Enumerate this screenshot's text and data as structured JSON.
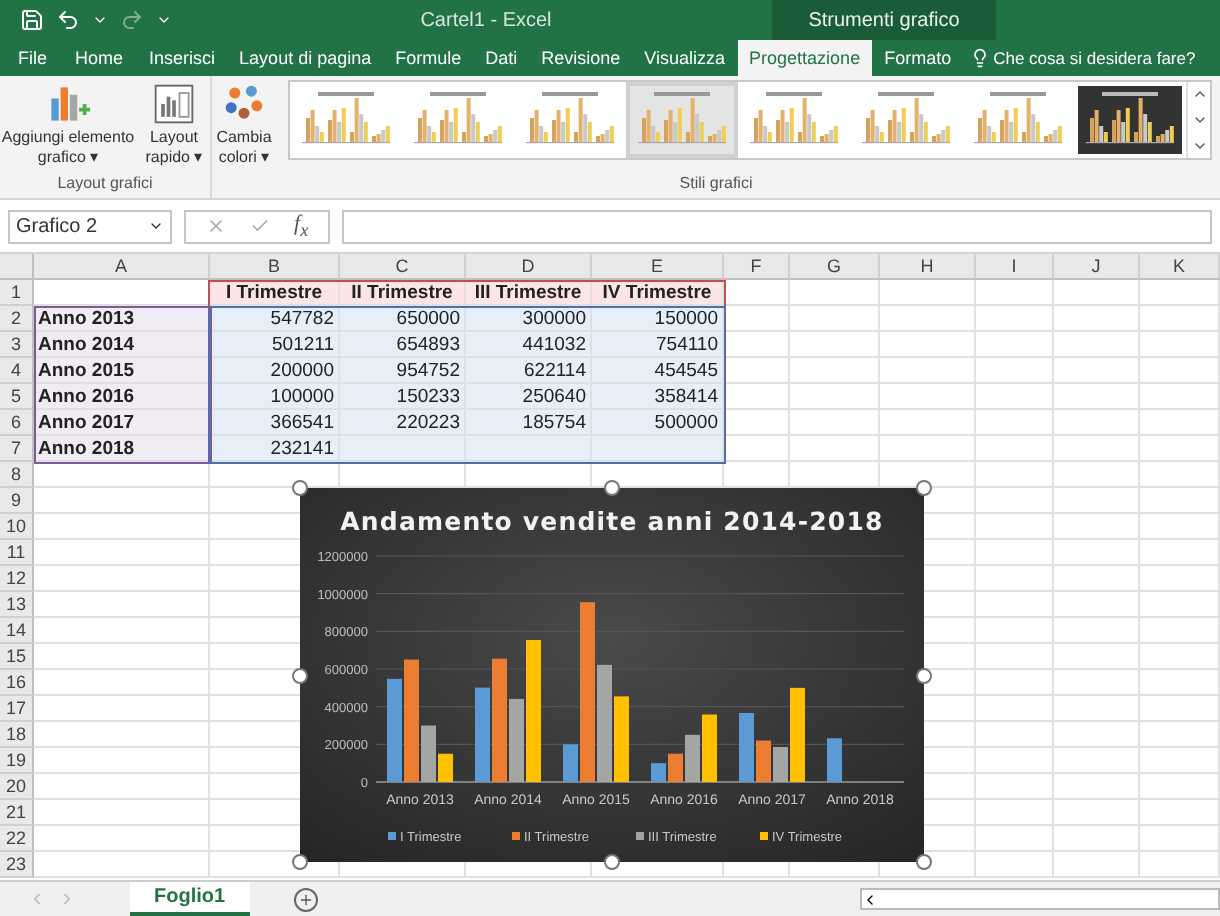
{
  "title_bar": {
    "title": "Cartel1 - Excel",
    "context_label": "Strumenti grafico"
  },
  "ribbon_tabs": [
    {
      "label": "File",
      "selected": false
    },
    {
      "label": "Home",
      "selected": false
    },
    {
      "label": "Inserisci",
      "selected": false
    },
    {
      "label": "Layout di pagina",
      "selected": false
    },
    {
      "label": "Formule",
      "selected": false
    },
    {
      "label": "Dati",
      "selected": false
    },
    {
      "label": "Revisione",
      "selected": false
    },
    {
      "label": "Visualizza",
      "selected": false
    },
    {
      "label": "Progettazione",
      "selected": true
    },
    {
      "label": "Formato",
      "selected": false
    }
  ],
  "tell_me": "Che cosa si desidera fare?",
  "ribbon": {
    "layout_group": {
      "name": "Layout grafici",
      "add_element": [
        "Aggiungi elemento",
        "grafico ▾"
      ],
      "quick_layout": [
        "Layout",
        "rapido ▾"
      ]
    },
    "styles_group": {
      "name": "Stili grafici",
      "change_colors": [
        "Cambia",
        "colori ▾"
      ],
      "styles": [
        {
          "kind": "light",
          "selected": false
        },
        {
          "kind": "light",
          "selected": false
        },
        {
          "kind": "light",
          "selected": false
        },
        {
          "kind": "shaded",
          "selected": true
        },
        {
          "kind": "light",
          "selected": false
        },
        {
          "kind": "light",
          "selected": false
        },
        {
          "kind": "light",
          "selected": false
        },
        {
          "kind": "dark",
          "selected": false
        }
      ]
    }
  },
  "formula_bar": {
    "name_box": "Grafico 2",
    "fx": "f$_{x}$"
  },
  "sheet": {
    "columns": [
      "A",
      "B",
      "C",
      "D",
      "E",
      "F",
      "G",
      "H",
      "I",
      "J",
      "K"
    ],
    "row_numbers": [
      "1",
      "2",
      "3",
      "4",
      "5",
      "6",
      "7",
      "8",
      "9",
      "10",
      "11",
      "12",
      "13",
      "14",
      "15",
      "16",
      "17",
      "18",
      "19",
      "20",
      "21",
      "22",
      "23"
    ],
    "header_row": [
      "I Trimestre",
      "II Trimestre",
      "III Trimestre",
      "IV Trimestre"
    ],
    "data_rows": [
      {
        "label": "Anno 2013",
        "values": [
          "547782",
          "650000",
          "300000",
          "150000"
        ]
      },
      {
        "label": "Anno 2014",
        "values": [
          "501211",
          "654893",
          "441032",
          "754110"
        ]
      },
      {
        "label": "Anno 2015",
        "values": [
          "200000",
          "954752",
          "622114",
          "454545"
        ]
      },
      {
        "label": "Anno 2016",
        "values": [
          "100000",
          "150233",
          "250640",
          "358414"
        ]
      },
      {
        "label": "Anno 2017",
        "values": [
          "366541",
          "220223",
          "185754",
          "500000"
        ]
      },
      {
        "label": "Anno 2018",
        "values": [
          "232141"
        ]
      }
    ]
  },
  "chart": {
    "chart_data": {
      "type": "bar",
      "title": "Andamento vendite anni 2014-2018",
      "categories": [
        "Anno 2013",
        "Anno 2014",
        "Anno 2015",
        "Anno 2016",
        "Anno 2017",
        "Anno 2018"
      ],
      "series": [
        {
          "name": "I Trimestre",
          "color": "#5b9bd5",
          "values": [
            547782,
            501211,
            200000,
            100000,
            366541,
            232141
          ]
        },
        {
          "name": "II Trimestre",
          "color": "#ed7d31",
          "values": [
            650000,
            654893,
            954752,
            150233,
            220223,
            null
          ]
        },
        {
          "name": "III Trimestre",
          "color": "#a5a5a5",
          "values": [
            300000,
            441032,
            622114,
            250640,
            185754,
            null
          ]
        },
        {
          "name": "IV Trimestre",
          "color": "#ffc000",
          "values": [
            150000,
            754110,
            454545,
            358414,
            500000,
            null
          ]
        }
      ],
      "ylim": [
        0,
        1200000
      ],
      "grid": true,
      "legend": true,
      "yticks": [
        {
          "value": 0,
          "label": "0"
        },
        {
          "value": 200000,
          "label": "200000"
        },
        {
          "value": 400000,
          "label": "400000"
        },
        {
          "value": 600000,
          "label": "600000"
        },
        {
          "value": 800000,
          "label": "800000"
        },
        {
          "value": 1000000,
          "label": "1000000"
        },
        {
          "value": 1200000,
          "label": "1200000"
        }
      ]
    }
  },
  "sheet_tabs": [
    {
      "label": "Foglio1",
      "selected": true
    }
  ]
}
